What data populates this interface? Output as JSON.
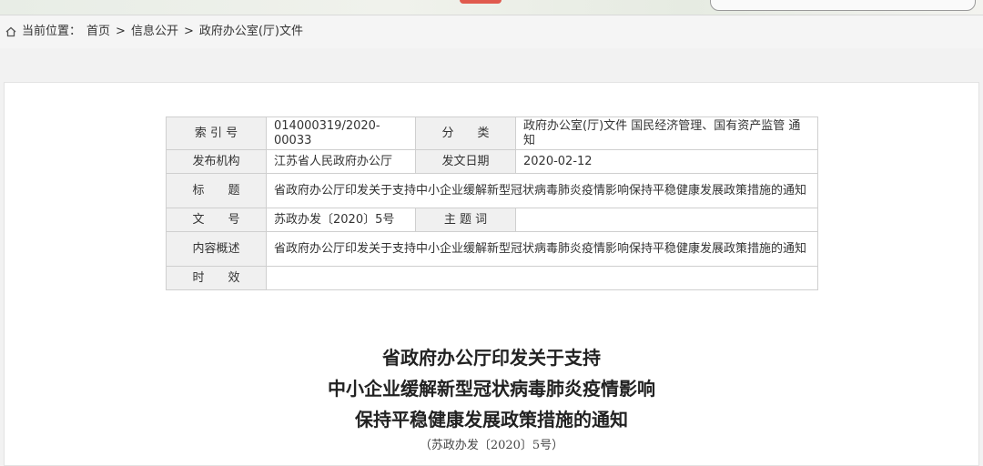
{
  "breadcrumb": {
    "label": "当前位置：",
    "separator": ">",
    "items": [
      "首页",
      "信息公开",
      "政府办公室(厅)文件"
    ]
  },
  "meta": {
    "index_label": "索 引 号",
    "index_value": "014000319/2020-00033",
    "category_label": "分　　类",
    "category_value": "政府办公室(厅)文件 国民经济管理、国有资产监管 通知",
    "issuer_label": "发布机构",
    "issuer_value": "江苏省人民政府办公厅",
    "date_label": "发文日期",
    "date_value": "2020-02-12",
    "title_label": "标　　题",
    "title_value": "省政府办公厅印发关于支持中小企业缓解新型冠状病毒肺炎疫情影响保持平稳健康发展政策措施的通知",
    "doc_no_label": "文　　号",
    "doc_no_value": "苏政办发〔2020〕5号",
    "keywords_label": "主 题 词",
    "keywords_value": "",
    "summary_label": "内容概述",
    "summary_value": "省政府办公厅印发关于支持中小企业缓解新型冠状病毒肺炎疫情影响保持平稳健康发展政策措施的通知",
    "validity_label": "时　　效",
    "validity_value": ""
  },
  "document": {
    "title_lines": [
      "省政府办公厅印发关于支持",
      "中小企业缓解新型冠状病毒肺炎疫情影响",
      "保持平稳健康发展政策措施的通知"
    ],
    "number": "（苏政办发〔2020〕5号）"
  },
  "icons": {
    "breadcrumb_home": "home-icon"
  },
  "colors": {
    "label_bg": "#f0f0f0",
    "border": "#cfcfcf",
    "page_bg": "#f2f2f2"
  }
}
